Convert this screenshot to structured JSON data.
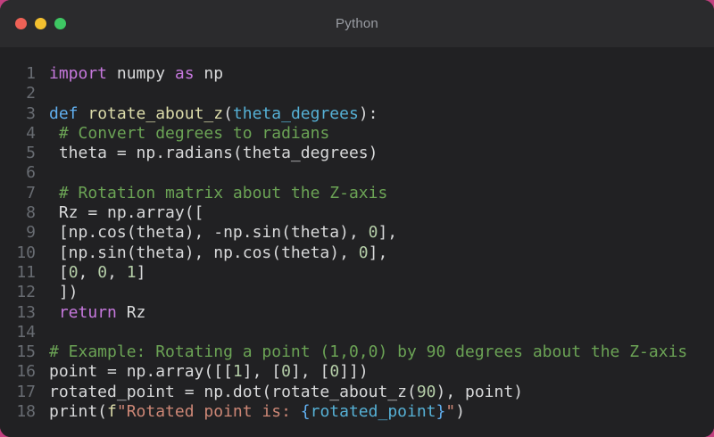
{
  "window": {
    "title": "Python"
  },
  "colors": {
    "page_bg": "#c2407f",
    "titlebar_bg": "#2b2b2d",
    "code_bg": "#212123",
    "title_fg": "#9a9da3",
    "traffic_lights": {
      "close": "#ee6156",
      "minimize": "#f3c02f",
      "maximize": "#3ec763"
    },
    "syntax": {
      "pl": "#d8d9da",
      "kw": "#c678dd",
      "def": "#61afef",
      "fn": "#dcdcaa",
      "param": "#56b1d6",
      "cm": "#6ba355",
      "num": "#b5cea8",
      "str": "#cd8776",
      "brace": "#61afef",
      "ln": "#686c72"
    }
  },
  "code": {
    "language": "Python",
    "lines": [
      {
        "n": "1",
        "tokens": [
          [
            "kw",
            "import"
          ],
          [
            "pl",
            " numpy "
          ],
          [
            "kw",
            "as"
          ],
          [
            "pl",
            " np"
          ]
        ]
      },
      {
        "n": "2",
        "tokens": []
      },
      {
        "n": "3",
        "tokens": [
          [
            "def",
            "def"
          ],
          [
            "pl",
            " "
          ],
          [
            "fn",
            "rotate_about_z"
          ],
          [
            "pl",
            "("
          ],
          [
            "param",
            "theta_degrees"
          ],
          [
            "pl",
            "):"
          ]
        ]
      },
      {
        "n": "4",
        "tokens": [
          [
            "pl",
            " "
          ],
          [
            "cm",
            "# Convert degrees to radians"
          ]
        ]
      },
      {
        "n": "5",
        "tokens": [
          [
            "pl",
            " theta = np.radians(theta_degrees)"
          ]
        ]
      },
      {
        "n": "6",
        "tokens": []
      },
      {
        "n": "7",
        "tokens": [
          [
            "pl",
            " "
          ],
          [
            "cm",
            "# Rotation matrix about the Z-axis"
          ]
        ]
      },
      {
        "n": "8",
        "tokens": [
          [
            "pl",
            " Rz = np.array(["
          ]
        ]
      },
      {
        "n": "9",
        "tokens": [
          [
            "pl",
            " [np.cos(theta), -np.sin(theta), "
          ],
          [
            "num",
            "0"
          ],
          [
            "pl",
            "],"
          ]
        ]
      },
      {
        "n": "10",
        "tokens": [
          [
            "pl",
            " [np.sin(theta), np.cos(theta), "
          ],
          [
            "num",
            "0"
          ],
          [
            "pl",
            "],"
          ]
        ]
      },
      {
        "n": "11",
        "tokens": [
          [
            "pl",
            " ["
          ],
          [
            "num",
            "0"
          ],
          [
            "pl",
            ", "
          ],
          [
            "num",
            "0"
          ],
          [
            "pl",
            ", "
          ],
          [
            "num",
            "1"
          ],
          [
            "pl",
            "]"
          ]
        ]
      },
      {
        "n": "12",
        "tokens": [
          [
            "pl",
            " ])"
          ]
        ]
      },
      {
        "n": "13",
        "tokens": [
          [
            "pl",
            " "
          ],
          [
            "kw",
            "return"
          ],
          [
            "pl",
            " Rz"
          ]
        ]
      },
      {
        "n": "14",
        "tokens": []
      },
      {
        "n": "15",
        "tokens": [
          [
            "cm",
            "# Example: Rotating a point (1,0,0) by 90 degrees about the Z-axis"
          ]
        ]
      },
      {
        "n": "16",
        "tokens": [
          [
            "pl",
            "point = np.array([["
          ],
          [
            "num",
            "1"
          ],
          [
            "pl",
            "], ["
          ],
          [
            "num",
            "0"
          ],
          [
            "pl",
            "], ["
          ],
          [
            "num",
            "0"
          ],
          [
            "pl",
            "]])"
          ]
        ]
      },
      {
        "n": "17",
        "tokens": [
          [
            "pl",
            "rotated_point = np.dot(rotate_about_z("
          ],
          [
            "num",
            "90"
          ],
          [
            "pl",
            "), point)"
          ]
        ]
      },
      {
        "n": "18",
        "tokens": [
          [
            "pl",
            "print("
          ],
          [
            "fn",
            "f"
          ],
          [
            "str",
            "\"Rotated point is: "
          ],
          [
            "brace",
            "{"
          ],
          [
            "param",
            "rotated_point"
          ],
          [
            "brace",
            "}"
          ],
          [
            "str",
            "\""
          ],
          [
            "pl",
            ")"
          ]
        ]
      }
    ]
  }
}
